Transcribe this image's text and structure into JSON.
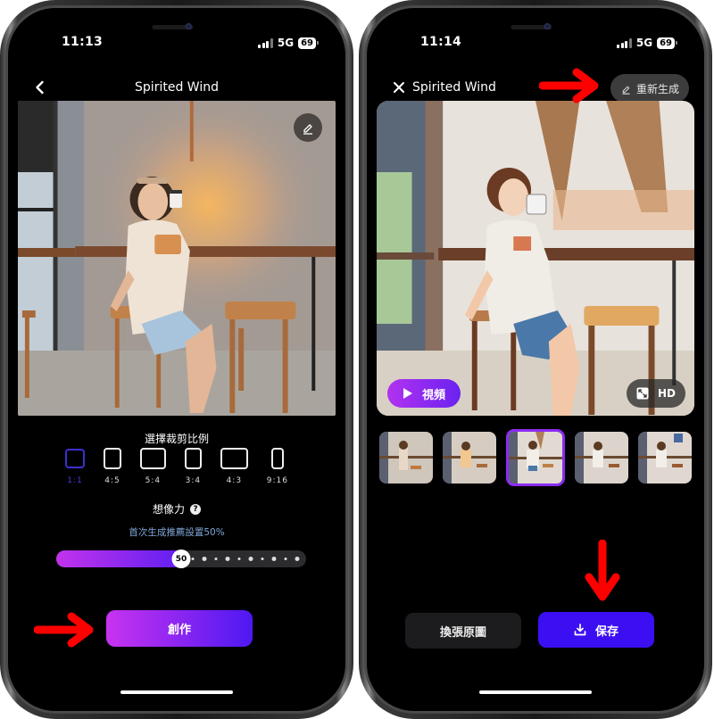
{
  "colors": {
    "accent_gradient_start": "#c833f0",
    "accent_gradient_end": "#4e18f2",
    "save_button": "#3c0ff2",
    "selected_ratio": "#3d2fd0",
    "hint_text": "#7fa7d8",
    "annotation_arrow": "#ff0000"
  },
  "left_screen": {
    "status": {
      "time": "11:13",
      "network": "5G",
      "battery": "69"
    },
    "nav": {
      "title": "Spirited Wind",
      "back_icon": "chevron-left-icon"
    },
    "photo": {
      "description": "original photo of woman holding coffee cup in cafe",
      "edit_icon": "pencil-icon"
    },
    "crop": {
      "title": "選擇裁剪比例",
      "ratios": [
        {
          "label": "1:1",
          "selected": true
        },
        {
          "label": "4:5",
          "selected": false
        },
        {
          "label": "5:4",
          "selected": false
        },
        {
          "label": "3:4",
          "selected": false
        },
        {
          "label": "4:3",
          "selected": false
        },
        {
          "label": "9:16",
          "selected": false
        }
      ]
    },
    "imagination": {
      "title": "想像力",
      "help_icon": "?",
      "hint": "首次生成推薦設置50%",
      "value": 50,
      "min": 0,
      "max": 100
    },
    "create_button": "創作"
  },
  "right_screen": {
    "status": {
      "time": "11:14",
      "network": "5G",
      "battery": "69"
    },
    "nav": {
      "title": "Spirited Wind",
      "close_icon": "close-icon",
      "regenerate_label": "重新生成"
    },
    "photo": {
      "description": "anime-style generated image of woman holding coffee cup in cafe"
    },
    "video_button": "視頻",
    "hd_button": "HD",
    "thumbnails": [
      {
        "selected": false
      },
      {
        "selected": false
      },
      {
        "selected": true
      },
      {
        "selected": false
      },
      {
        "selected": false
      }
    ],
    "swap_original_button": "換張原圖",
    "save_button": "保存"
  }
}
